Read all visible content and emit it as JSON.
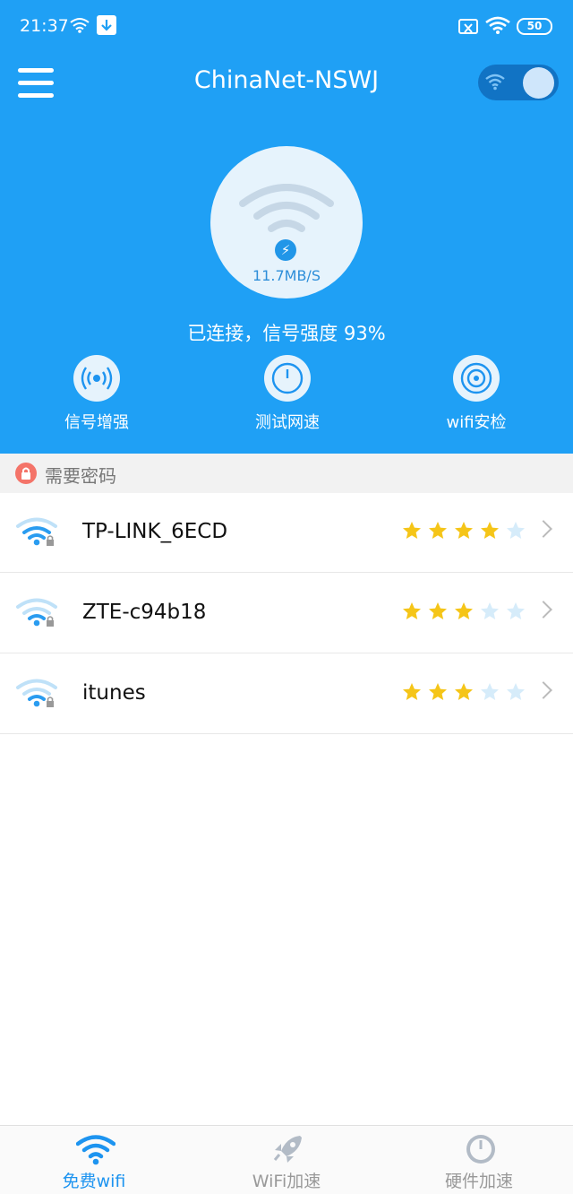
{
  "status_bar": {
    "time": "21:37",
    "battery": "50"
  },
  "header": {
    "title": "ChinaNet-NSWJ",
    "wifi_toggle_on": true
  },
  "connection": {
    "speed": "11.7MB/S",
    "status": "已连接，信号强度 93%"
  },
  "actions": [
    {
      "label": "信号增强",
      "icon": "signal-boost-icon"
    },
    {
      "label": "测试网速",
      "icon": "speedometer-icon"
    },
    {
      "label": "wifi安检",
      "icon": "security-check-icon"
    }
  ],
  "section": {
    "title": "需要密码"
  },
  "networks": [
    {
      "name": "TP-LINK_6ECD",
      "rating": 4,
      "max_rating": 5
    },
    {
      "name": "ZTE-c94b18",
      "rating": 3,
      "max_rating": 5
    },
    {
      "name": "itunes",
      "rating": 3,
      "max_rating": 5
    }
  ],
  "bottom_nav": [
    {
      "label": "免费wifi",
      "icon": "wifi-icon",
      "active": true
    },
    {
      "label": "WiFi加速",
      "icon": "rocket-icon",
      "active": false
    },
    {
      "label": "硬件加速",
      "icon": "gauge-icon",
      "active": false
    }
  ],
  "colors": {
    "primary": "#1fa0f5",
    "star_filled": "#f5c518",
    "star_empty": "#d6ecfa",
    "accent": "#1d94f0"
  }
}
